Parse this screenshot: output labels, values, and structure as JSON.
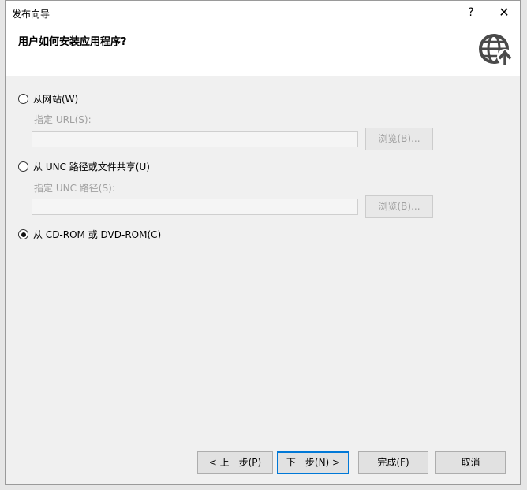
{
  "dialog": {
    "title": "发布向导",
    "help_label": "?",
    "close_label": "✕"
  },
  "header": {
    "heading": "用户如何安装应用程序?"
  },
  "options": {
    "website": {
      "label": "从网站(W)",
      "selected": false,
      "url_label": "指定 URL(S):",
      "url_value": "",
      "browse_label": "浏览(B)..."
    },
    "unc": {
      "label": "从 UNC 路径或文件共享(U)",
      "selected": false,
      "path_label": "指定 UNC 路径(S):",
      "path_value": "",
      "browse_label": "浏览(B)..."
    },
    "cdrom": {
      "label": "从 CD-ROM 或 DVD-ROM(C)",
      "selected": true
    }
  },
  "footer": {
    "prev_label": "< 上一步(P)",
    "next_label": "下一步(N) >",
    "finish_label": "完成(F)",
    "cancel_label": "取消"
  },
  "colors": {
    "accent": "#0078d7",
    "disabled_text": "#a0a0a0",
    "globe": "#4a4a4a"
  },
  "icons": {
    "globe": "globe-upload-icon"
  }
}
